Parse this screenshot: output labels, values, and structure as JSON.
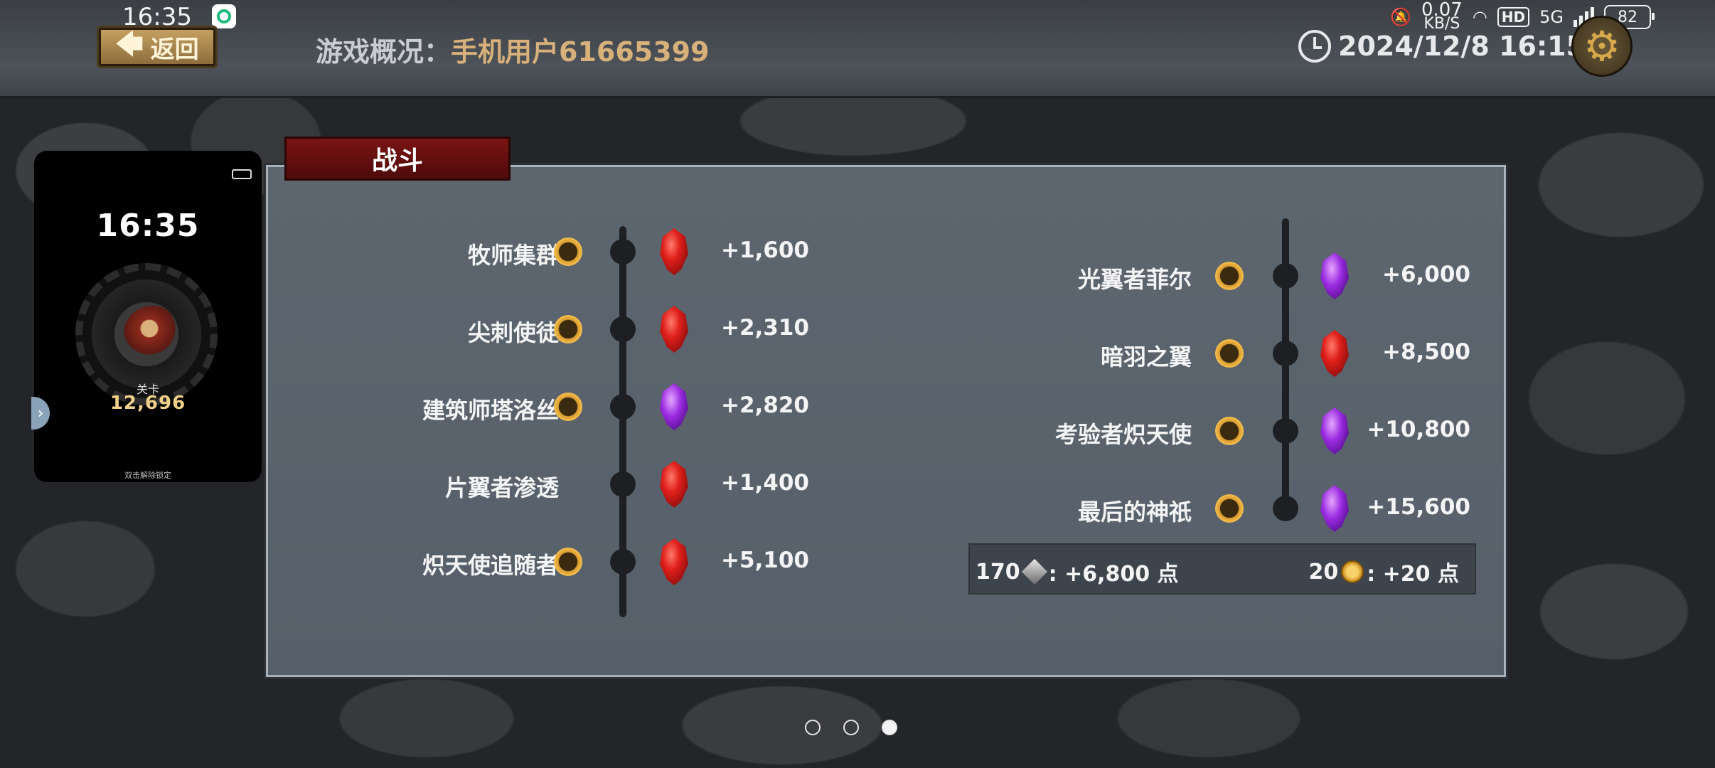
{
  "status_bar": {
    "time": "16:35",
    "net_speed_value": "0.07",
    "net_speed_unit": "KB/S",
    "hd": "HD",
    "network": "5G",
    "battery": "82"
  },
  "header": {
    "back_label": "返回",
    "overview_label": "游戏概况：",
    "user_name": "手机用户61665399",
    "datetime": "2024/12/8 16:15"
  },
  "phone_preview": {
    "time": "16:35",
    "stage_label": "关卡",
    "stage_value": "12,696",
    "hint": "双击解除锁定"
  },
  "section": {
    "title": "战斗"
  },
  "left_column": [
    {
      "name": "牧师集群",
      "gem": "red",
      "reward": "+1,600",
      "badge": true
    },
    {
      "name": "尖刺使徒",
      "gem": "red",
      "reward": "+2,310",
      "badge": true
    },
    {
      "name": "建筑师塔洛丝",
      "gem": "purple",
      "reward": "+2,820",
      "badge": true
    },
    {
      "name": "片翼者渗透",
      "gem": "red",
      "reward": "+1,400",
      "badge": false
    },
    {
      "name": "炽天使追随者",
      "gem": "red",
      "reward": "+5,100",
      "badge": true
    }
  ],
  "right_column": [
    {
      "name": "光翼者菲尔",
      "gem": "purple",
      "reward": "+6,000",
      "badge": true
    },
    {
      "name": "暗羽之翼",
      "gem": "red",
      "reward": "+8,500",
      "badge": true
    },
    {
      "name": "考验者炽天使",
      "gem": "purple",
      "reward": "+10,800",
      "badge": true
    },
    {
      "name": "最后的神祇",
      "gem": "purple",
      "reward": "+15,600",
      "badge": true
    }
  ],
  "summary": {
    "diamond_count": "170",
    "diamond_points": ": +6,800 点",
    "coin_count": "20",
    "coin_points": ": +20 点"
  },
  "pager": {
    "pages": 3,
    "active": 3
  }
}
